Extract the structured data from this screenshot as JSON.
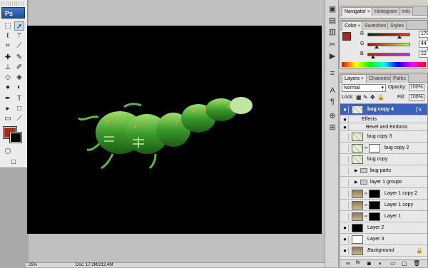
{
  "toolbox": {
    "logo": "Ps"
  },
  "icons": {
    "tools": [
      "move-icon",
      "marquee-icon",
      "lasso-icon",
      "magic-wand-icon",
      "crop-icon",
      "slice-icon",
      "healing-brush-icon",
      "brush-icon",
      "clone-stamp-icon",
      "history-brush-icon",
      "eraser-icon",
      "paint-bucket-icon",
      "blur-icon",
      "dodge-icon",
      "pen-icon",
      "type-icon",
      "path-select-icon",
      "shape-icon",
      "notes-icon",
      "eyedropper-icon",
      "hand-icon",
      "zoom-icon"
    ]
  },
  "colors": {
    "foreground": "#a82a1d",
    "background": "#000000",
    "selection": "#3a62b6"
  },
  "status": {
    "zoom": "25%",
    "doc": "Doc: 17.2M/212.4M"
  },
  "navigator_panel": {
    "tabs": [
      "Navigator",
      "Histogram",
      "Info"
    ]
  },
  "color_panel": {
    "tabs": [
      "Color",
      "Swatches",
      "Styles"
    ],
    "sliders": [
      {
        "label": "R",
        "value": "178",
        "level": 0.7
      },
      {
        "label": "G",
        "value": "44",
        "level": 0.17
      },
      {
        "label": "B",
        "value": "22",
        "level": 0.09
      }
    ]
  },
  "layers_panel": {
    "tabs": [
      "Layers",
      "Channels",
      "Paths"
    ],
    "blend_mode": "Normal",
    "opacity_label": "Opacity:",
    "opacity_value": "100%",
    "lock_label": "Lock:",
    "fill_label": "Fill:",
    "fill_value": "100%",
    "layers": [
      {
        "name": "bug copy 4",
        "selected": true,
        "visible": true
      },
      {
        "name": "Effects",
        "selected": false,
        "visible": true
      },
      {
        "name": "Bevel and Emboss",
        "selected": false,
        "visible": true
      },
      {
        "name": "bug copy 3",
        "selected": false,
        "visible": false
      },
      {
        "name": "bug copy 2",
        "selected": false,
        "visible": false
      },
      {
        "name": "bug copy",
        "selected": false,
        "visible": false
      },
      {
        "name": "bug parts",
        "selected": false,
        "visible": false
      },
      {
        "name": "layer 1 groups",
        "selected": false,
        "visible": false
      },
      {
        "name": "Layer 1 copy 2",
        "selected": false,
        "visible": false
      },
      {
        "name": "Layer 1 copy",
        "selected": false,
        "visible": false
      },
      {
        "name": "Layer 1",
        "selected": false,
        "visible": false
      },
      {
        "name": "Layer 2",
        "selected": false,
        "visible": true
      },
      {
        "name": "Layer 3",
        "selected": false,
        "visible": true
      },
      {
        "name": "Background",
        "selected": false,
        "visible": true
      }
    ]
  }
}
